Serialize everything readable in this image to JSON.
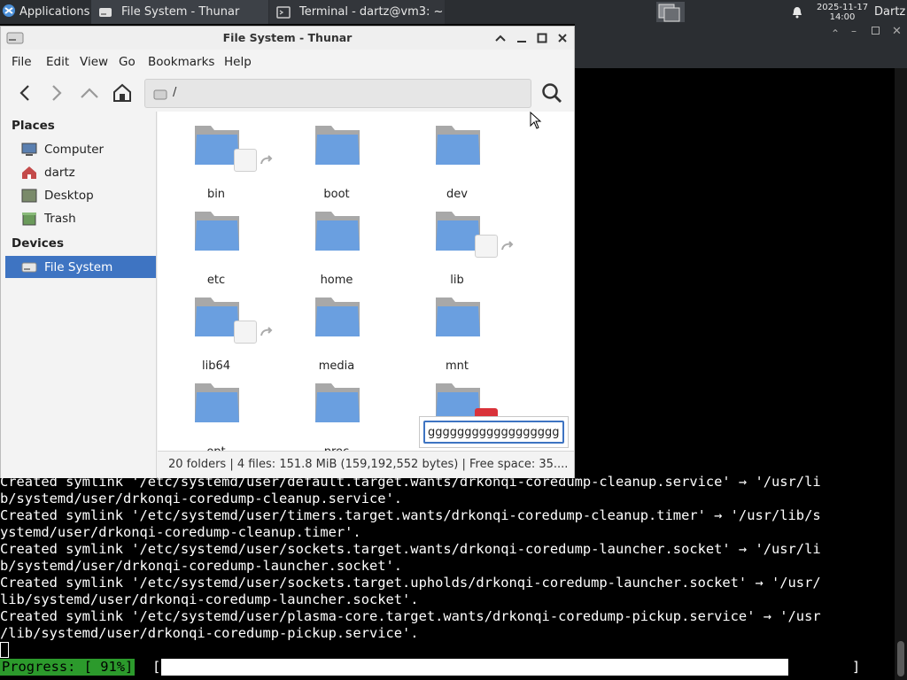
{
  "panel": {
    "apps_label": "Applications",
    "tasks": [
      {
        "label": "File System - Thunar"
      },
      {
        "label": "Terminal - dartz@vm3: ~"
      }
    ],
    "clock_date": "2025-11-17",
    "clock_time": "14:00",
    "user": "Dartz"
  },
  "thunar": {
    "title": "File System - Thunar",
    "menu": [
      "File",
      "Edit",
      "View",
      "Go",
      "Bookmarks",
      "Help"
    ],
    "location": "/",
    "sidebar": {
      "places_heading": "Places",
      "places": [
        "Computer",
        "dartz",
        "Desktop",
        "Trash"
      ],
      "devices_heading": "Devices",
      "devices": [
        "File System"
      ]
    },
    "files": [
      "bin",
      "boot",
      "dev",
      "etc",
      "home",
      "lib",
      "lib64",
      "media",
      "mnt",
      "opt",
      "proc"
    ],
    "rename_value": "ggggggggggggggggggggg",
    "status": "20 folders  |  4 files: 151.8 MiB (159,192,552 bytes)  |  Free space: 35...."
  },
  "terminal": {
    "lines": [
      "Created symlink '/etc/systemd/user/default.target.wants/drkonqi-coredump-cleanup.service' → '/usr/li",
      "b/systemd/user/drkonqi-coredump-cleanup.service'.",
      "Created symlink '/etc/systemd/user/timers.target.wants/drkonqi-coredump-cleanup.timer' → '/usr/lib/s",
      "ystemd/user/drkonqi-coredump-cleanup.timer'.",
      "Created symlink '/etc/systemd/user/sockets.target.wants/drkonqi-coredump-launcher.socket' → '/usr/li",
      "b/systemd/user/drkonqi-coredump-launcher.socket'.",
      "Created symlink '/etc/systemd/user/sockets.target.upholds/drkonqi-coredump-launcher.socket' → '/usr/",
      "lib/systemd/user/drkonqi-coredump-launcher.socket'.",
      "Created symlink '/etc/systemd/user/plasma-core.target.wants/drkonqi-coredump-pickup.service' → '/usr",
      "/lib/systemd/user/drkonqi-coredump-pickup.service'."
    ],
    "progress_label": "Progress: [ 91%]",
    "progress_open": "[",
    "progress_close": "]",
    "progress_fraction": 0.91,
    "progress_color": "#2c9a2c"
  },
  "colors": {
    "selection": "#3e74c2",
    "folder": "#6a9fe0"
  }
}
